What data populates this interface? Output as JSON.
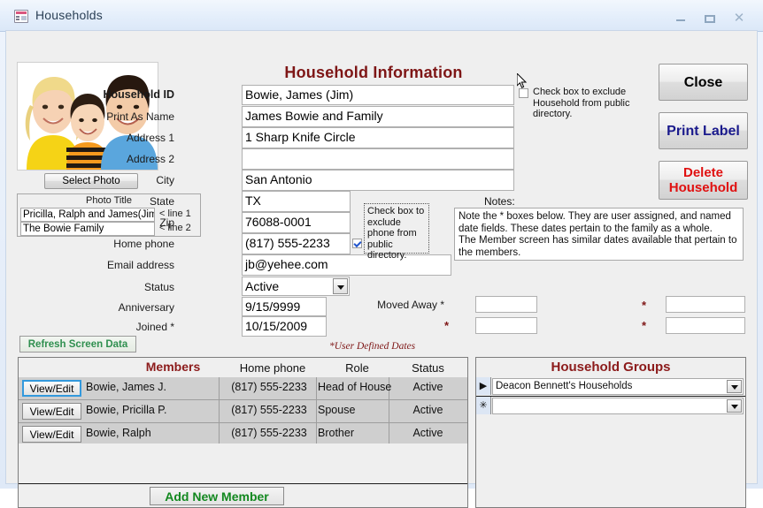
{
  "window": {
    "title": "Households",
    "icon": "form-table-icon",
    "controls": {
      "minimize": "–",
      "maximize": "□",
      "close": "✕"
    }
  },
  "header": {
    "title": "Household Information"
  },
  "photo": {
    "select_button": "Select Photo",
    "title_header": "Photo Title",
    "line1_value": "Pricilla, Ralph and James(Jim)",
    "line2_value": "The Bowie Family",
    "line1_label": "< line 1",
    "line2_label": "< line 2"
  },
  "fields": {
    "household_id": {
      "label": "Household ID",
      "value": "Bowie, James (Jim)"
    },
    "print_as_name": {
      "label": "Print As Name",
      "value": "James Bowie and Family"
    },
    "address1": {
      "label": "Address 1",
      "value": "1 Sharp Knife Circle"
    },
    "address2": {
      "label": "Address 2",
      "value": ""
    },
    "city": {
      "label": "City",
      "value": "San Antonio"
    },
    "state": {
      "label": "State",
      "value": "TX"
    },
    "zip": {
      "label": "Zip",
      "value": "76088-0001"
    },
    "home_phone": {
      "label": "Home phone",
      "value": "(817) 555-2233"
    },
    "email": {
      "label": "Email address",
      "value": "jb@yehee.com"
    },
    "status": {
      "label": "Status",
      "value": "Active"
    },
    "anniversary": {
      "label": "Anniversary",
      "value": "9/15/9999"
    },
    "joined": {
      "label": "Joined *",
      "value": "10/15/2009"
    },
    "moved_away": {
      "label": "Moved Away *",
      "value": ""
    },
    "user_date_2": {
      "value": ""
    },
    "user_date_3": {
      "value": ""
    },
    "user_date_4": {
      "value": ""
    },
    "user_defined_note": "*User Defined Dates"
  },
  "exclude_household": {
    "checked": false,
    "text": "Check box to exclude Household from public directory."
  },
  "exclude_phone": {
    "checked": true,
    "text": "Check box to exclude phone from public directory."
  },
  "notes": {
    "label": "Notes:",
    "value": "Note the * boxes below.   They are user assigned, and named date fields.  These dates pertain to the family as a whole.\nThe Member screen has similar dates available that pertain to the members."
  },
  "buttons": {
    "close": "Close",
    "print_label": "Print Label",
    "delete_line1": "Delete",
    "delete_line2": "Household",
    "refresh": "Refresh Screen Data",
    "add_new_member": "Add New Member",
    "view_edit": "View/Edit"
  },
  "members": {
    "title": "Members",
    "columns": [
      "Home phone",
      "Role",
      "Status"
    ],
    "rows": [
      {
        "name": "Bowie, James J.",
        "phone": "(817) 555-2233",
        "role": "Head of House",
        "status": "Active"
      },
      {
        "name": "Bowie, Pricilla P.",
        "phone": "(817) 555-2233",
        "role": "Spouse",
        "status": "Active"
      },
      {
        "name": "Bowie, Ralph",
        "phone": "(817) 555-2233",
        "role": "Brother",
        "status": "Active"
      }
    ]
  },
  "household_groups": {
    "title": "Household Groups",
    "rows": [
      {
        "selector": "▶",
        "value": "Deacon Bennett's Households"
      },
      {
        "selector": "✳",
        "value": ""
      }
    ]
  },
  "colors": {
    "heading_red": "#7e1616",
    "delete_red": "#e01010",
    "print_blue": "#1a1a8c",
    "green": "#12881f",
    "refresh_green": "#2f8f4f"
  }
}
